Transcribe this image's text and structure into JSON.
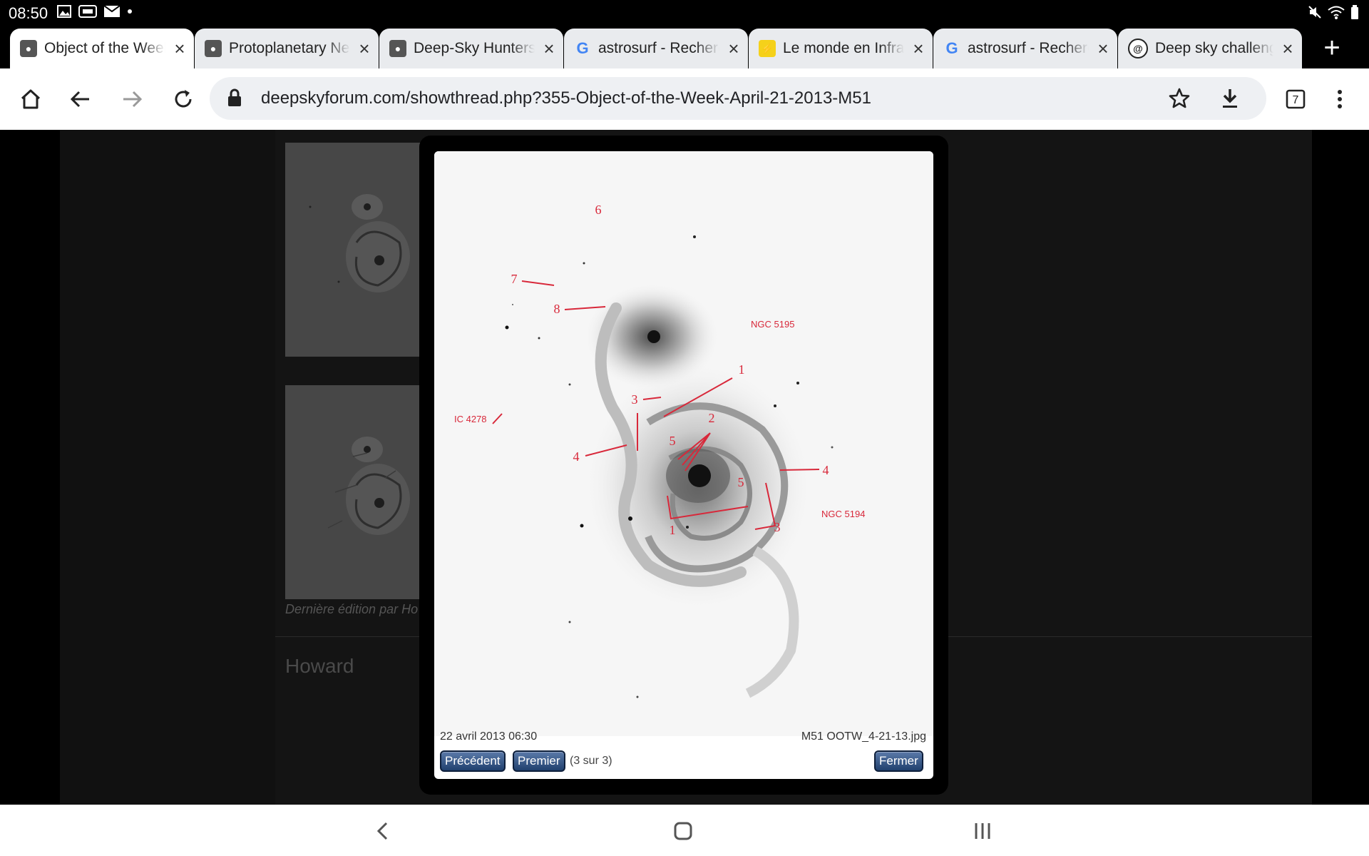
{
  "status_bar": {
    "time": "08:50",
    "left_icons": [
      "image-icon",
      "cast-icon",
      "mail-icon",
      "dot-icon"
    ],
    "right_icons": [
      "mute-icon",
      "wifi-icon",
      "battery-icon"
    ]
  },
  "tabs": [
    {
      "title": "Object of the Week",
      "favicon": "galaxy",
      "active": true
    },
    {
      "title": "Protoplanetary Nebula",
      "favicon": "galaxy",
      "active": false
    },
    {
      "title": "Deep-Sky Hunters",
      "favicon": "galaxy",
      "active": false
    },
    {
      "title": "astrosurf - Rechercher",
      "favicon": "google",
      "active": false
    },
    {
      "title": "Le monde en Infrarouge",
      "favicon": "lm",
      "active": false
    },
    {
      "title": "astrosurf - Rechercher",
      "favicon": "google",
      "active": false
    },
    {
      "title": "Deep sky challenge",
      "favicon": "ds",
      "active": false
    }
  ],
  "tab_count": "7",
  "address": {
    "url": "deepskyforum.com/showthread.php?355-Object-of-the-Week-April-21-2013-M51"
  },
  "page": {
    "edit_note": "Dernière édition par Ho",
    "username": "Howard"
  },
  "lightbox": {
    "date": "22 avril 2013 06:30",
    "filename": "M51 OOTW_4-21-13.jpg",
    "prev_label": "Précédent",
    "first_label": "Premier",
    "count": "(3 sur 3)",
    "close_label": "Fermer",
    "annotations": {
      "n6": "6",
      "n7": "7",
      "n8": "8",
      "ngc5195": "NGC 5195",
      "n1a": "1",
      "n3a": "3",
      "n2": "2",
      "ic4278": "IC 4278",
      "n5a": "5",
      "n4a": "4",
      "n5b": "5",
      "n4b": "4",
      "ngc5194": "NGC 5194",
      "n1b": "1",
      "n3b": "3"
    },
    "annotation_color": "#d8283a"
  }
}
